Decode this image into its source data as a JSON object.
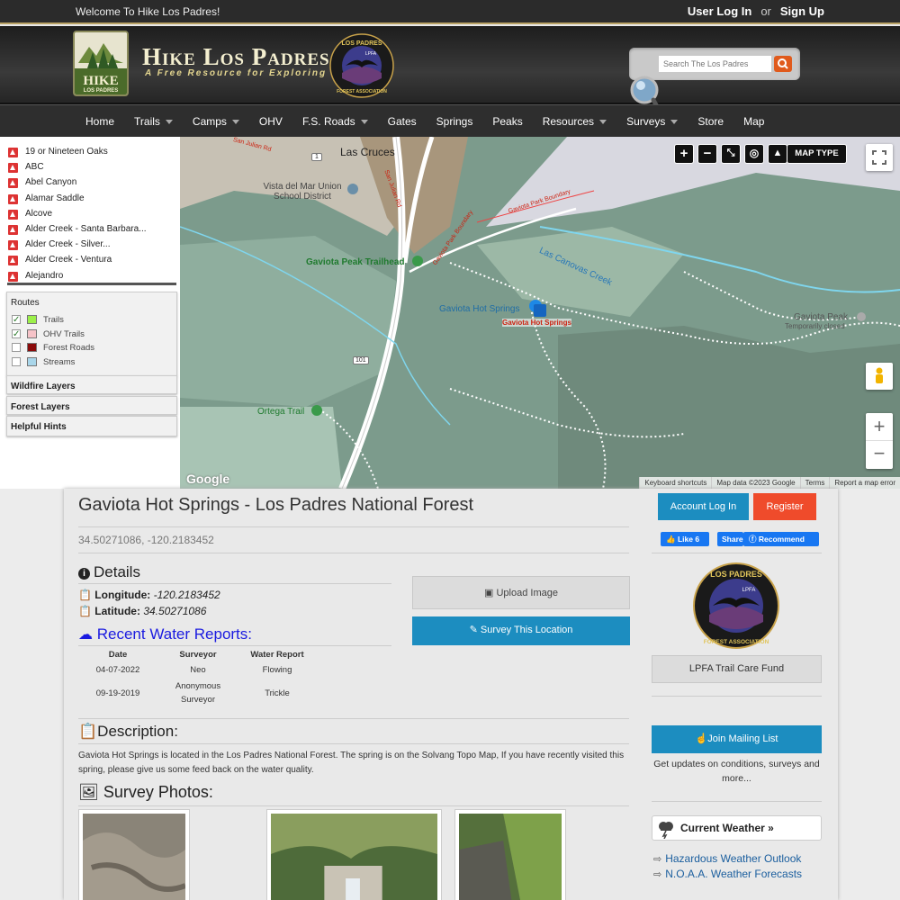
{
  "topbar": {
    "welcome": "Welcome To Hike Los Padres!",
    "login": "User Log In",
    "or": "or",
    "signup": "Sign Up"
  },
  "header": {
    "logo_line1": "HIKE",
    "logo_line2": "LOS PADRES",
    "title": "Hike Los Padres",
    "tagline": "A Free Resource for Exploring",
    "badge_top": "LOS PADRES",
    "badge_bottom": "FOREST ASSOCIATION",
    "badge_center": "LPFA"
  },
  "search": {
    "placeholder": "Search The Los Padres"
  },
  "nav": [
    {
      "label": "Home",
      "caret": false
    },
    {
      "label": "Trails",
      "caret": true
    },
    {
      "label": "Camps",
      "caret": true
    },
    {
      "label": "OHV",
      "caret": false
    },
    {
      "label": "F.S. Roads",
      "caret": true
    },
    {
      "label": "Gates",
      "caret": false
    },
    {
      "label": "Springs",
      "caret": false
    },
    {
      "label": "Peaks",
      "caret": false
    },
    {
      "label": "Resources",
      "caret": true
    },
    {
      "label": "Surveys",
      "caret": true
    },
    {
      "label": "Store",
      "caret": false
    },
    {
      "label": "Map",
      "caret": false
    }
  ],
  "locations": [
    "19 or Nineteen Oaks",
    "ABC",
    "Abel Canyon",
    "Alamar Saddle",
    "Alcove",
    "Alder Creek - Santa Barbara...",
    "Alder Creek - Silver...",
    "Alder Creek - Ventura",
    "Alejandro"
  ],
  "routes": {
    "title": "Routes",
    "items": [
      {
        "label": "Trails",
        "checked": true,
        "color": "#9cf04a"
      },
      {
        "label": "OHV Trails",
        "checked": true,
        "color": "#f6c3c8"
      },
      {
        "label": "Forest Roads",
        "checked": false,
        "color": "#8b0b0b"
      },
      {
        "label": "Streams",
        "checked": false,
        "color": "#a9d6ea"
      }
    ]
  },
  "panels": {
    "wildfire": "Wildfire Layers",
    "forest": "Forest Layers",
    "hints": "Helpful Hints"
  },
  "map": {
    "map_type": "MAP TYPE",
    "labels": {
      "las_cruces": "Las Cruces",
      "school": "Vista del Mar Union School District",
      "gaviota_trailhead": "Gaviota Peak Trailhead",
      "hot_springs": "Gaviota Hot Springs",
      "hot_springs_marker": "Gaviota Hot Springs",
      "gaviota_peak": "Gaviota Peak",
      "temp_closed": "Temporarily closed",
      "ortega": "Ortega Trail",
      "canovas": "Las Canovas Creek",
      "park_boundary": "Gaviota Park Boundary",
      "san_julian": "San Julian Rd",
      "route101": "101",
      "route1": "1"
    },
    "footer": [
      "Keyboard shortcuts",
      "Map data ©2023 Google",
      "Terms",
      "Report a map error"
    ],
    "google": "Google"
  },
  "page": {
    "title": "Gaviota Hot Springs - Los Padres National Forest",
    "coords": "34.50271086, -120.2183452",
    "details_heading": "Details",
    "longitude_label": "Longitude:",
    "longitude": "-120.2183452",
    "latitude_label": "Latitude:",
    "latitude": "34.50271086",
    "water_heading": "Recent Water Reports:",
    "water_table": {
      "headers": [
        "Date",
        "Surveyor",
        "Water Report"
      ],
      "rows": [
        [
          "04-07-2022",
          "Neo",
          "Flowing"
        ],
        [
          "09-19-2019",
          "Anonymous Surveyor",
          "Trickle"
        ]
      ]
    },
    "description_heading": "Description:",
    "description": "Gaviota Hot Springs is located in the Los Padres National Forest. The spring is on the Solvang Topo Map, If you have recently visited this spring, please give us some feed back on the water quality.",
    "photos_heading": "Survey Photos:",
    "upload_button": "Upload Image",
    "survey_button": "Survey This Location"
  },
  "sidebar": {
    "account_login": "Account Log In",
    "register": "Register",
    "fb_like": "Like 6",
    "fb_share": "Share",
    "fb_recommend": "Recommend",
    "trail_fund": "LPFA Trail Care Fund",
    "join_mailing": "Join Mailing List",
    "mailing_text": "Get updates on conditions, surveys and more...",
    "current_weather": "Current Weather »",
    "link1": "Hazardous Weather Outlook",
    "link2": "N.O.A.A. Weather Forecasts"
  },
  "colors": {
    "accent_blue": "#1c8dc0",
    "register_red": "#ef4b2b",
    "water_heading_blue": "#1a1ae0",
    "nav_bg": "#2e2e2e"
  }
}
